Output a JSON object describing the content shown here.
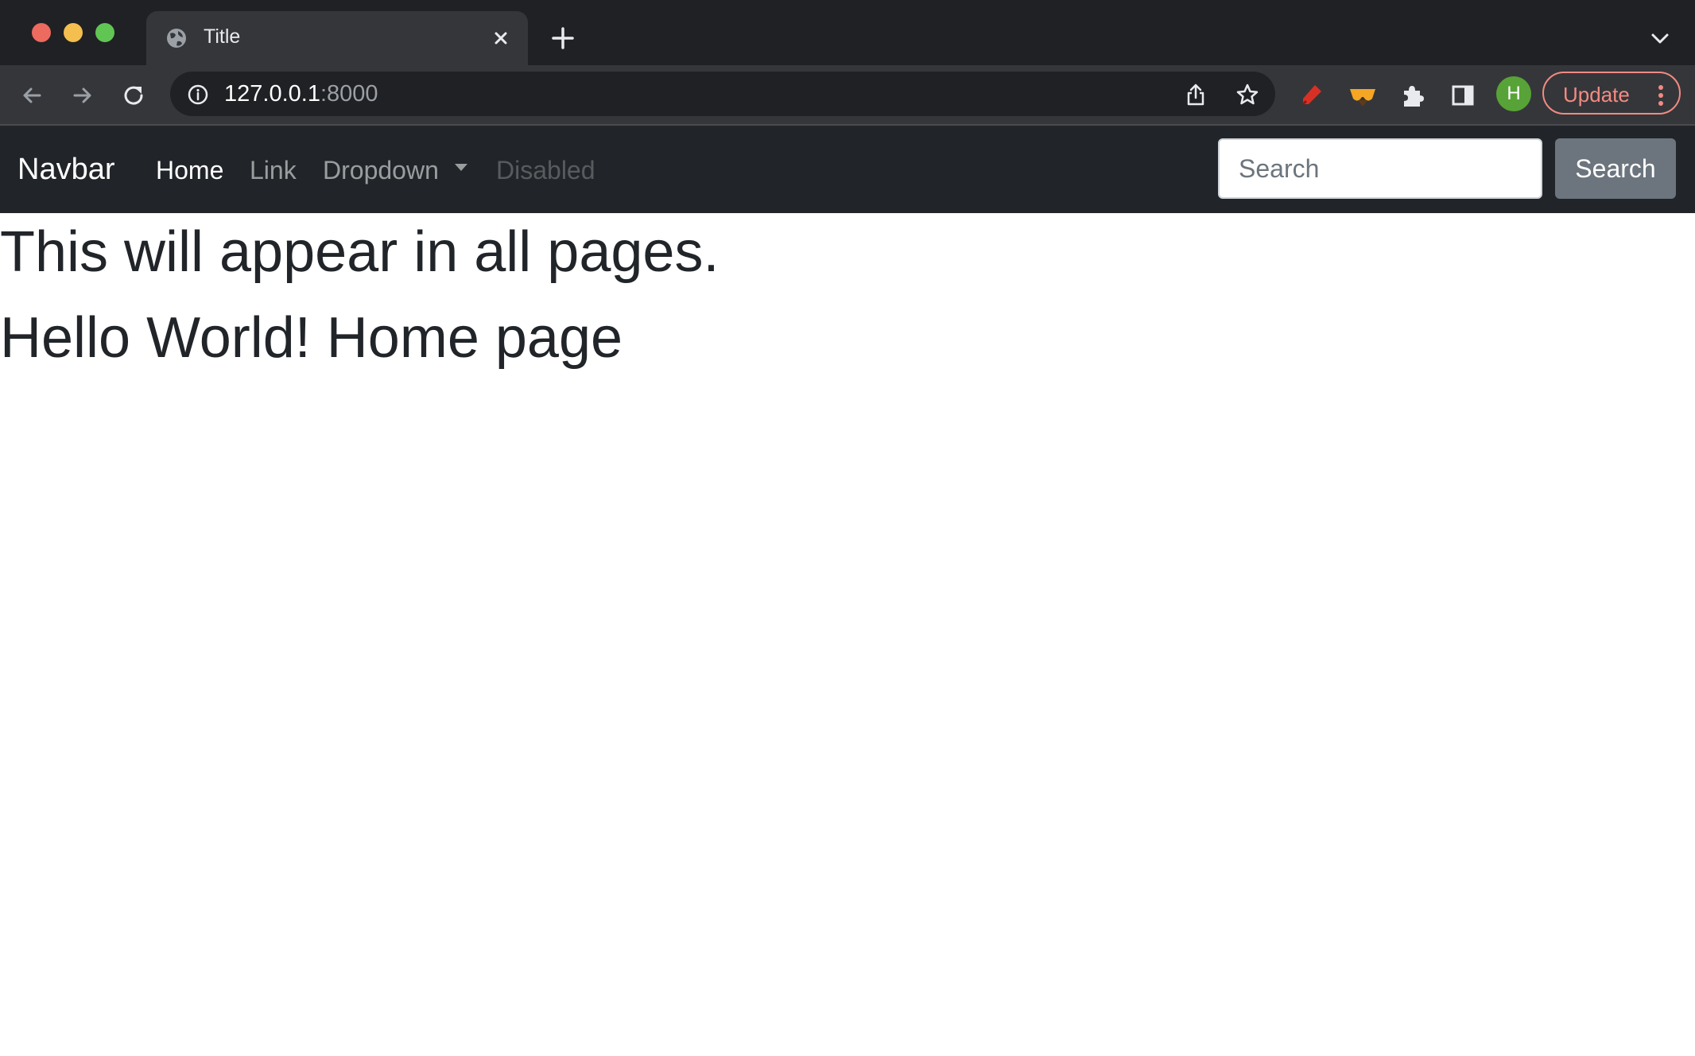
{
  "browser": {
    "tab": {
      "title": "Title"
    },
    "address": {
      "host": "127.0.0.1",
      "port": ":8000"
    },
    "profile_initial": "H",
    "update_label": "Update",
    "colors": {
      "close": "#ed6a5e",
      "minimize": "#f4bf4f",
      "maximize": "#61c554",
      "update": "#f28b82",
      "avatar": "#58a337"
    },
    "icons": [
      "globe-icon",
      "close-icon",
      "plus-icon",
      "chevron-down-icon",
      "back-arrow-icon",
      "forward-arrow-icon",
      "reload-icon",
      "info-icon",
      "share-icon",
      "star-icon",
      "marker-extension-icon",
      "glasses-extension-icon",
      "puzzle-icon",
      "side-panel-icon",
      "more-vertical-icon"
    ]
  },
  "navbar": {
    "brand": "Navbar",
    "links": [
      {
        "label": "Home",
        "state": "active"
      },
      {
        "label": "Link",
        "state": "normal"
      },
      {
        "label": "Dropdown",
        "state": "normal"
      },
      {
        "label": "Disabled",
        "state": "disabled"
      }
    ],
    "search": {
      "placeholder": "Search",
      "button_label": "Search"
    },
    "colors": {
      "background": "#212529",
      "button": "#6c757d"
    }
  },
  "content": {
    "heading": "This will appear in all pages.",
    "subheading": "Hello World! Home page"
  }
}
